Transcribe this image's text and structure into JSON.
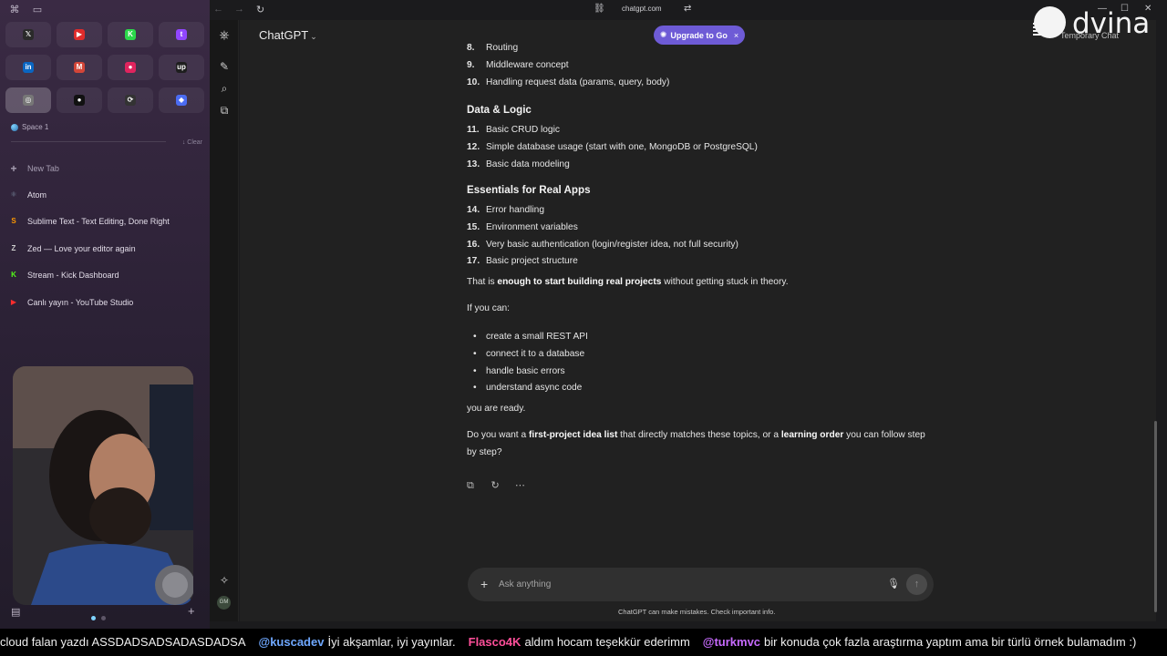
{
  "browser": {
    "url": "chatgpt.com"
  },
  "favorites": [
    {
      "name": "x-icon",
      "glyph": "𝕏",
      "color": "#2a2a2a"
    },
    {
      "name": "youtube-icon",
      "glyph": "▶",
      "color": "#e02b2b"
    },
    {
      "name": "kick-icon",
      "glyph": "K",
      "color": "#2bd94a"
    },
    {
      "name": "twitch-icon",
      "glyph": "t",
      "color": "#9146ff"
    },
    {
      "name": "linkedin-icon",
      "glyph": "in",
      "color": "#0a66c2"
    },
    {
      "name": "gmail-icon",
      "glyph": "M",
      "color": "#d44638"
    },
    {
      "name": "record-icon",
      "glyph": "●",
      "color": "#e0245e"
    },
    {
      "name": "upwork-icon",
      "glyph": "up",
      "color": "#1e1e1e"
    },
    {
      "name": "chatgpt-icon",
      "glyph": "◎",
      "color": "#777777"
    },
    {
      "name": "circle-app-icon",
      "glyph": "●",
      "color": "#111111"
    },
    {
      "name": "sync-app-icon",
      "glyph": "⟳",
      "color": "#333333"
    },
    {
      "name": "gemini-icon",
      "glyph": "◆",
      "color": "#4b6cf2"
    }
  ],
  "sidebar": {
    "space_label": "Space 1",
    "clear_label": "↓ Clear",
    "new_tab_label": "New Tab",
    "tabs": [
      {
        "label": "Atom",
        "icon": "⚛",
        "color": "#7a8aa0"
      },
      {
        "label": "Sublime Text - Text Editing, Done Right",
        "icon": "S",
        "color": "#ff9800"
      },
      {
        "label": "Zed — Love your editor again",
        "icon": "Z",
        "color": "#cfcfcf"
      },
      {
        "label": "Stream - Kick Dashboard",
        "icon": "K",
        "color": "#53fc18"
      },
      {
        "label": "Canlı yayın - YouTube Studio",
        "icon": "▶",
        "color": "#ff2d2d"
      }
    ]
  },
  "chat": {
    "model_label": "ChatGPT",
    "upgrade_label": "Upgrade to Go",
    "temp_label": "Temporary Chat",
    "list_a": [
      {
        "num": "8.",
        "text": "Routing"
      },
      {
        "num": "9.",
        "text": "Middleware concept"
      },
      {
        "num": "10.",
        "text": "Handling request data (params, query, body)"
      }
    ],
    "heading_data": "Data & Logic",
    "list_b": [
      {
        "num": "11.",
        "text": "Basic CRUD logic"
      },
      {
        "num": "12.",
        "text": "Simple database usage (start with one, MongoDB or PostgreSQL)"
      },
      {
        "num": "13.",
        "text": "Basic data modeling"
      }
    ],
    "heading_real": "Essentials for Real Apps",
    "list_c": [
      {
        "num": "14.",
        "text": "Error handling"
      },
      {
        "num": "15.",
        "text": "Environment variables"
      },
      {
        "num": "16.",
        "text": "Very basic authentication (login/register idea, not full security)"
      },
      {
        "num": "17.",
        "text": "Basic project structure"
      }
    ],
    "p1_pre": "That is ",
    "p1_bold": "enough to start building real projects",
    "p1_post": " without getting stuck in theory.",
    "p2": "If you can:",
    "bullets": [
      "create a small REST API",
      "connect it to a database",
      "handle basic errors",
      "understand async code"
    ],
    "p3": "you are ready.",
    "p4_a": "Do you want a ",
    "p4_b": "first-project idea list",
    "p4_c": " that directly matches these topics, or a ",
    "p4_d": "learning order",
    "p4_e": " you can follow step by step?",
    "composer_placeholder": "Ask anything",
    "disclaimer": "ChatGPT can make mistakes. Check important info.",
    "avatar_initials": "GM"
  },
  "overlay": {
    "brand": "dvina"
  },
  "ticker": [
    {
      "user": "",
      "text": "cloud falan yazdı ASSDADSADSADASDADSA",
      "color": "#ffffff"
    },
    {
      "user": "@kuscadev",
      "text": "İyi akşamlar, iyi yayınlar.",
      "color": "#6fa8ff"
    },
    {
      "user": "Flasco4K",
      "text": "aldım hocam teşekkür ederimm",
      "color": "#ff4f9a"
    },
    {
      "user": "@turkmvc",
      "text": "bir konuda çok fazla araştırma yaptım ama bir türlü örnek bulamadım :)",
      "color": "#c86bff"
    }
  ]
}
